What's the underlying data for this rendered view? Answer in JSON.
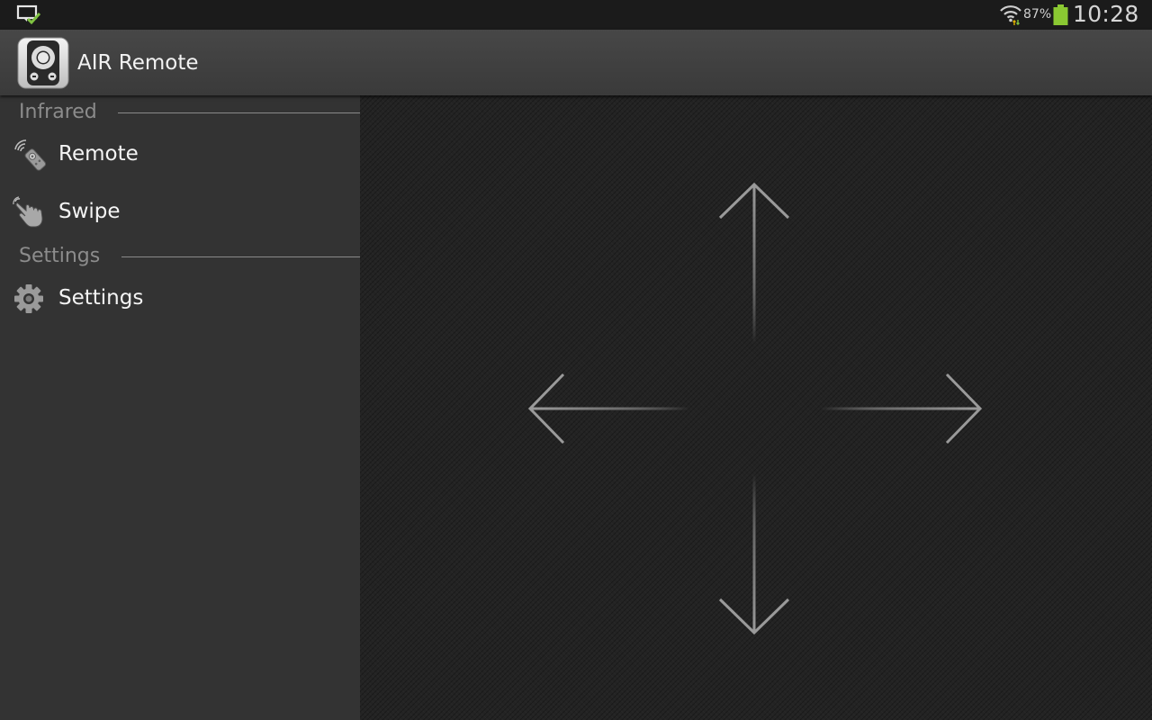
{
  "status_bar": {
    "notification_icon": "notification-check-icon",
    "wifi_icon": "wifi-icon",
    "battery_percent": "87%",
    "battery_icon": "battery-icon",
    "battery_color": "#8ac832",
    "clock": "10:28"
  },
  "action_bar": {
    "app_icon": "remote-app-icon",
    "title": "AIR Remote"
  },
  "sidebar": {
    "sections": [
      {
        "header": "Infrared",
        "items": [
          {
            "label": "Remote",
            "icon": "remote-icon"
          },
          {
            "label": "Swipe",
            "icon": "swipe-hand-icon"
          }
        ]
      },
      {
        "header": "Settings",
        "items": [
          {
            "label": "Settings",
            "icon": "gear-icon"
          }
        ]
      }
    ]
  },
  "swipe_pad": {
    "arrows": [
      "arrow-up-icon",
      "arrow-left-icon",
      "arrow-right-icon",
      "arrow-down-icon"
    ],
    "arrow_color": "#9a9a9a"
  },
  "colors": {
    "status_bar_bg": "#1b1b1b",
    "action_bar_bg": "#404040",
    "sidebar_bg": "#333333",
    "pad_bg": "#232323",
    "section_header_text": "#8c8c8c",
    "item_text": "#f4f4f4"
  }
}
